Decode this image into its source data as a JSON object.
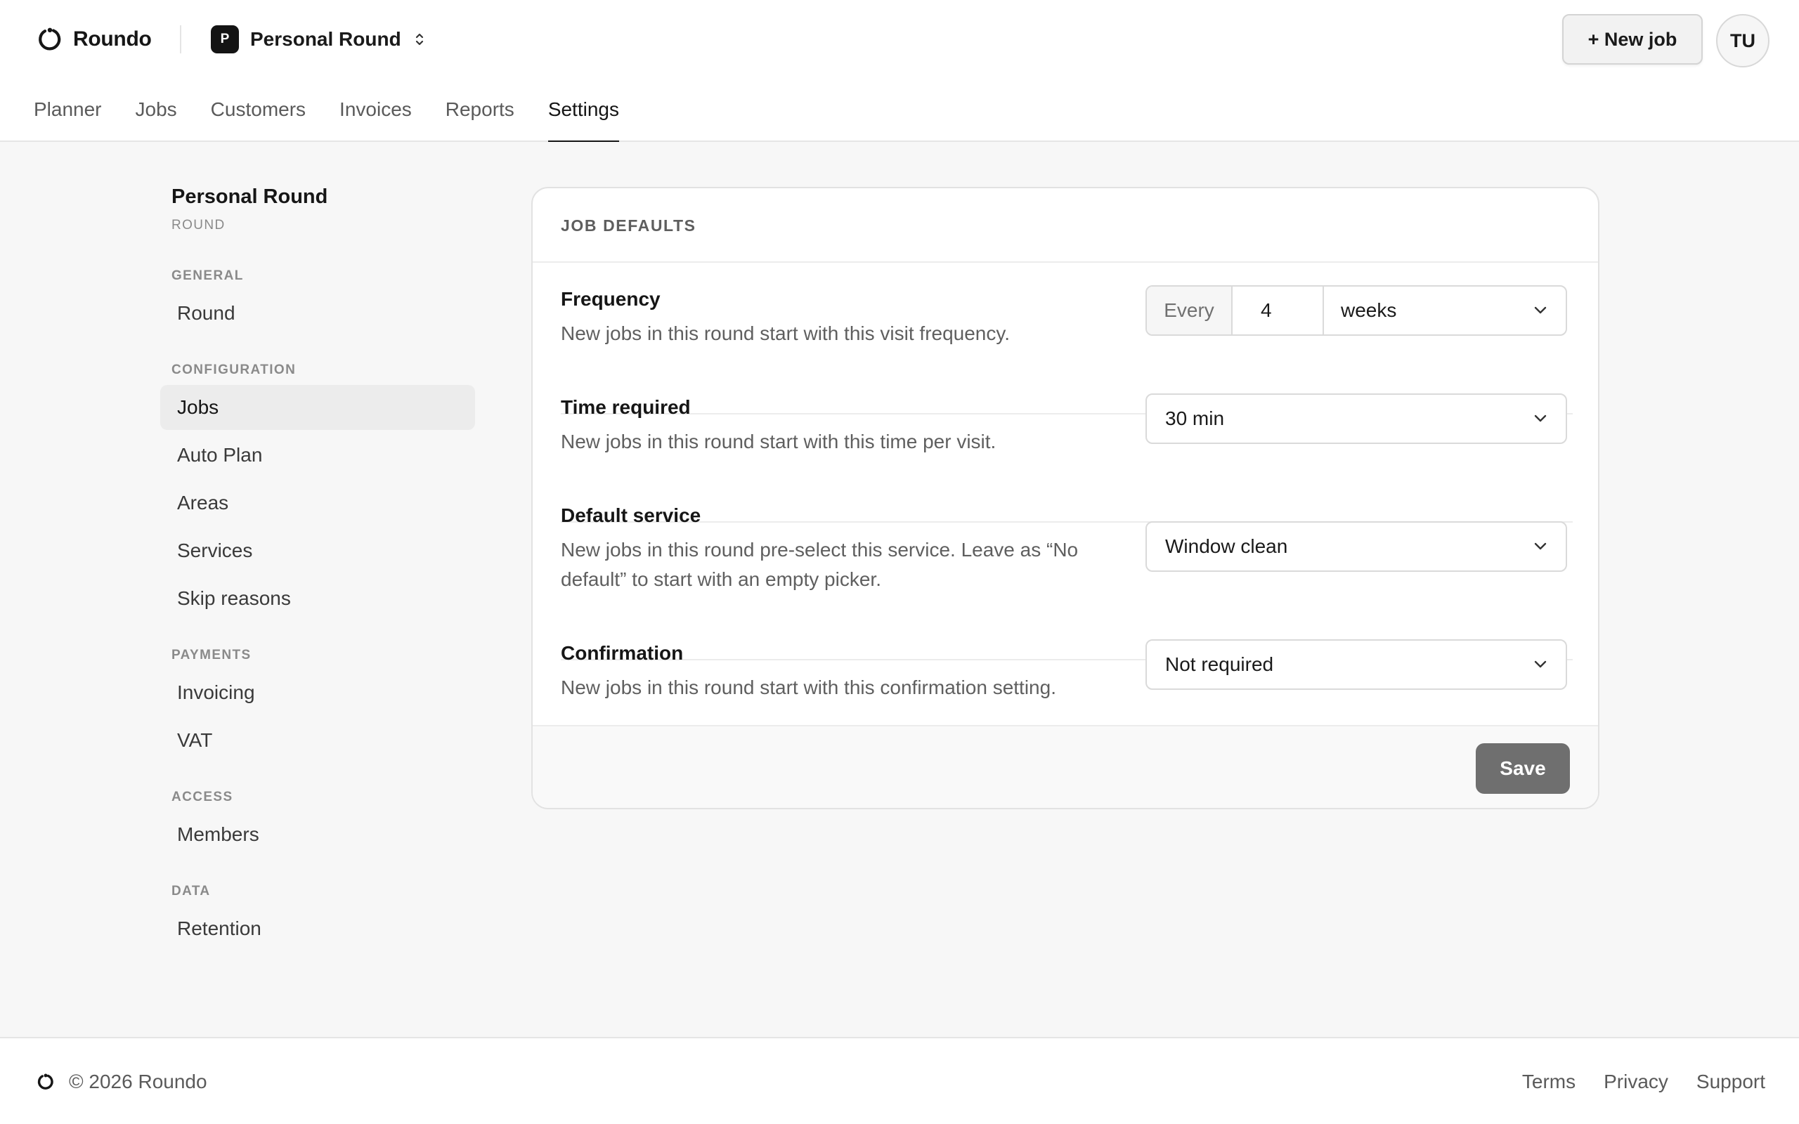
{
  "app": {
    "name": "Roundo",
    "round_initial": "P",
    "round_name": "Personal Round",
    "new_job_label": "+ New job",
    "avatar_initials": "TU"
  },
  "nav": {
    "tabs": [
      {
        "label": "Planner",
        "active": false
      },
      {
        "label": "Jobs",
        "active": false
      },
      {
        "label": "Customers",
        "active": false
      },
      {
        "label": "Invoices",
        "active": false
      },
      {
        "label": "Reports",
        "active": false
      },
      {
        "label": "Settings",
        "active": true
      }
    ]
  },
  "sidebar": {
    "title": "Personal Round",
    "subtitle": "ROUND",
    "sections": [
      {
        "label": "GENERAL",
        "items": [
          "Round"
        ]
      },
      {
        "label": "CONFIGURATION",
        "items": [
          "Jobs",
          "Auto Plan",
          "Areas",
          "Services",
          "Skip reasons"
        ]
      },
      {
        "label": "PAYMENTS",
        "items": [
          "Invoicing",
          "VAT"
        ]
      },
      {
        "label": "ACCESS",
        "items": [
          "Members"
        ]
      },
      {
        "label": "DATA",
        "items": [
          "Retention"
        ]
      }
    ],
    "active_item": "Jobs"
  },
  "card": {
    "heading": "JOB DEFAULTS",
    "frequency": {
      "title": "Frequency",
      "description": "New jobs in this round start with this visit frequency.",
      "prefix": "Every",
      "value": "4",
      "unit": "weeks"
    },
    "time_required": {
      "title": "Time required",
      "description": "New jobs in this round start with this time per visit.",
      "value": "30 min"
    },
    "default_service": {
      "title": "Default service",
      "description": "New jobs in this round pre-select this service. Leave as “No default” to start with an empty picker.",
      "value": "Window clean"
    },
    "confirmation": {
      "title": "Confirmation",
      "description": "New jobs in this round start with this confirmation setting.",
      "value": "Not required"
    },
    "save_label": "Save"
  },
  "footer": {
    "copyright": "© 2026 Roundo",
    "links": [
      "Terms",
      "Privacy",
      "Support"
    ]
  },
  "colors": {
    "accent": "#151515",
    "background": "#f7f7f7",
    "save_button": "#6f6f6f",
    "muted_text": "#5f5f5f"
  },
  "icons": {
    "logo": "circle-arrow-icon",
    "switcher": "chevron-up-down-icon",
    "select": "chevron-down-icon"
  }
}
